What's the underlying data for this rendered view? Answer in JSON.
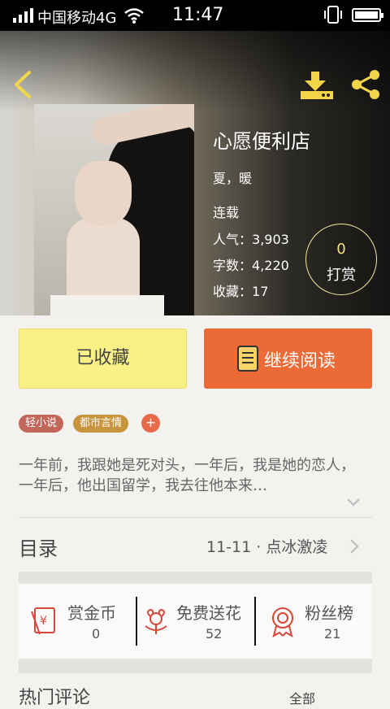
{
  "status": {
    "carrier": "中国移动4G",
    "time": "11:47"
  },
  "book": {
    "title": "心愿便利店",
    "author": "夏，暖",
    "status": "连载",
    "popularity_label": "人气：",
    "popularity": "3,903",
    "words_label": "字数：",
    "words": "4,220",
    "favorites_label": "收藏：",
    "favorites": "17"
  },
  "reward": {
    "count": "0",
    "label": "打赏"
  },
  "actions": {
    "collected": "已收藏",
    "read": "继续阅读"
  },
  "tags": [
    {
      "label": "轻小说",
      "color": "#c2665a"
    },
    {
      "label": "都市言情",
      "color": "#c9953c"
    }
  ],
  "tag_add": "+",
  "description": "一年前，我跟她是死对头，一年后，我是她的恋人，一年后，他出国留学，我去往他本来…",
  "toc": {
    "label": "目录",
    "chapter": "11-11 · 点冰激凌"
  },
  "stats": [
    {
      "label": "赏金币",
      "value": "0",
      "icon": "red-envelope-icon"
    },
    {
      "label": "免费送花",
      "value": "52",
      "icon": "flower-icon"
    },
    {
      "label": "粉丝榜",
      "value": "21",
      "icon": "medal-icon"
    }
  ],
  "comments": {
    "label": "热门评论",
    "all": "全部"
  },
  "colors": {
    "accent": "#ec6a36",
    "collected_bg": "#f9f186",
    "icon_red": "#d9463a"
  }
}
